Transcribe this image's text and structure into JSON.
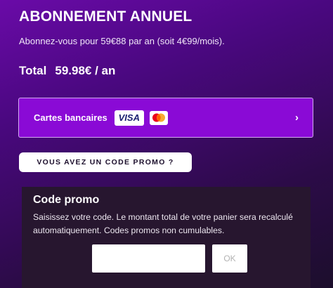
{
  "subscription": {
    "title": "ABONNEMENT ANNUEL",
    "description": "Abonnez-vous pour 59€88 par an (soit 4€99/mois).",
    "total_label": "Total",
    "total_amount": "59.98€ / an"
  },
  "payment": {
    "label": "Cartes bancaires",
    "visa_text": "VISA",
    "icons": [
      "visa-logo",
      "mastercard-logo",
      "chevron-right"
    ],
    "chevron": "›",
    "colors": {
      "button_bg": "#8a0ad6",
      "border": "#d3a8f2"
    }
  },
  "promo_toggle": {
    "label": "VOUS AVEZ UN CODE PROMO ?"
  },
  "promo_panel": {
    "title": "Code promo",
    "text": "Saisissez votre code. Le montant total de votre panier sera recalculé automatiquement. Codes promos non cumulables.",
    "input_value": "",
    "input_placeholder": "",
    "ok_label": "OK"
  },
  "colors": {
    "accent": "#8a0ad6",
    "panel_bg": "#27162f"
  }
}
